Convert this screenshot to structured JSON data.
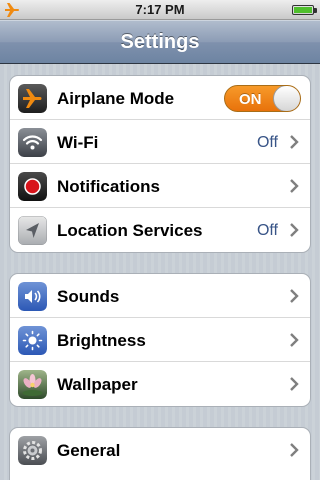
{
  "status_bar": {
    "time": "7:17 PM",
    "airplane_icon": "airplane-icon",
    "battery_icon": "battery-icon"
  },
  "nav": {
    "title": "Settings"
  },
  "groups": [
    {
      "rows": [
        {
          "label": "Airplane Mode",
          "icon": "airplane-icon",
          "toggle": "ON"
        },
        {
          "label": "Wi-Fi",
          "icon": "wifi-icon",
          "value": "Off"
        },
        {
          "label": "Notifications",
          "icon": "notifications-icon"
        },
        {
          "label": "Location Services",
          "icon": "location-icon",
          "value": "Off"
        }
      ]
    },
    {
      "rows": [
        {
          "label": "Sounds",
          "icon": "speaker-icon"
        },
        {
          "label": "Brightness",
          "icon": "sun-icon"
        },
        {
          "label": "Wallpaper",
          "icon": "flower-icon"
        }
      ]
    },
    {
      "rows": [
        {
          "label": "General",
          "icon": "gear-icon"
        }
      ]
    }
  ],
  "colors": {
    "toggle_on": "#f7891a",
    "detail_text": "#385487",
    "nav_bar": "#6d84a2",
    "background": "#c5ccd4"
  }
}
